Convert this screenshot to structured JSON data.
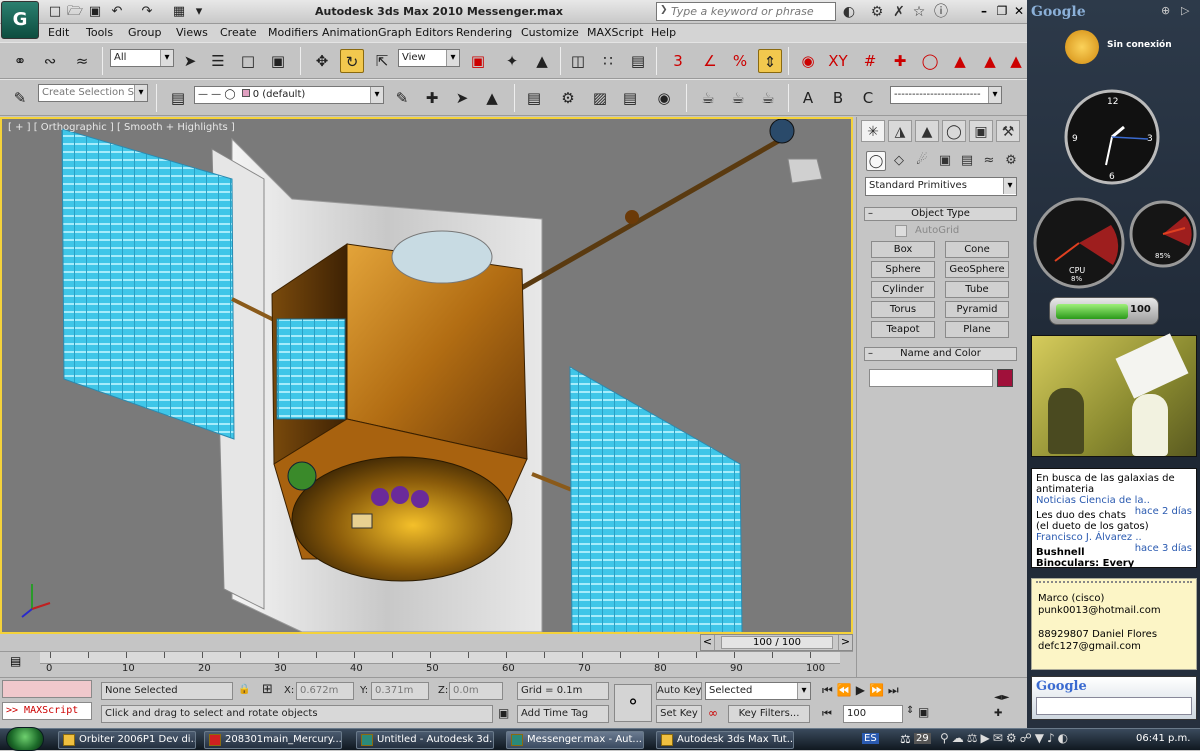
{
  "window": {
    "title": "Autodesk 3ds Max  2010      Messenger.max",
    "logo": "G"
  },
  "search": {
    "placeholder": "Type a keyword or phrase"
  },
  "menu": [
    "Edit",
    "Tools",
    "Group",
    "Views",
    "Create",
    "Modifiers",
    "Animation",
    "Graph Editors",
    "Rendering",
    "Customize",
    "MAXScript",
    "Help"
  ],
  "toolbar1": {
    "filter": "All",
    "refcoord": "View"
  },
  "toolbar2": {
    "selection_set": "Create Selection Se",
    "layer": "0 (default)"
  },
  "viewport": {
    "label": "[ + ] [ Orthographic ] [ Smooth + Highlights ]"
  },
  "cmdpanel": {
    "dropdown": "Standard Primitives",
    "object_type_title": "Object Type",
    "autogrid": "AutoGrid",
    "buttons": [
      "Box",
      "Cone",
      "Sphere",
      "GeoSphere",
      "Cylinder",
      "Tube",
      "Torus",
      "Pyramid",
      "Teapot",
      "Plane"
    ],
    "name_color_title": "Name and Color",
    "name_value": "",
    "swatch_color": "#a0103a"
  },
  "timeslider": {
    "label": "100 / 100"
  },
  "timeline": {
    "ticks": [
      "0",
      "10",
      "20",
      "30",
      "40",
      "50",
      "60",
      "70",
      "80",
      "90",
      "100"
    ]
  },
  "status": {
    "maxscript": ">> MAXScript",
    "selection": "None Selected",
    "x_label": "X:",
    "x": "0.672m",
    "y_label": "Y:",
    "y": "0.371m",
    "z_label": "Z:",
    "z": "0.0m",
    "grid": "Grid = 0.1m",
    "prompt": "Click and drag to select and rotate objects",
    "add_time_tag": "Add Time Tag",
    "auto_key": "Auto Key",
    "set_key": "Set Key",
    "key_mode": "Selected",
    "key_filters": "Key Filters...",
    "frame": "100"
  },
  "sidebar": {
    "google_title": "Google",
    "weather": "Sin conexión",
    "cpu_label": "CPU",
    "cpu_value": "8%",
    "mem_value": "85%",
    "battery": "100",
    "feeds": [
      {
        "title": "En busca de las galaxias de antimateria",
        "source": "Noticias Ciencia de la..",
        "age": "hace 2 días"
      },
      {
        "title": "Les duo des chats (el dueto de los gatos)",
        "source": "Francisco J. Álvarez ..",
        "age": "hace 3 días"
      },
      {
        "title": "Bushnell Binoculars: Every",
        "source": "",
        "age": ""
      }
    ],
    "notes": [
      "Marco (cisco)",
      "punk0013@hotmail.com",
      "",
      "88929807 Daniel Flores",
      "defc127@gmail.com"
    ],
    "google_search_title": "Google"
  },
  "taskbar": {
    "tasks": [
      "Orbiter 2006P1 Dev di...",
      "208301main_Mercury...",
      "Untitled - Autodesk 3d...",
      "Messenger.max - Aut...",
      "Autodesk 3ds Max Tut..."
    ],
    "lang": "ES",
    "tray_count": "29",
    "clock": "06:41 p.m."
  }
}
